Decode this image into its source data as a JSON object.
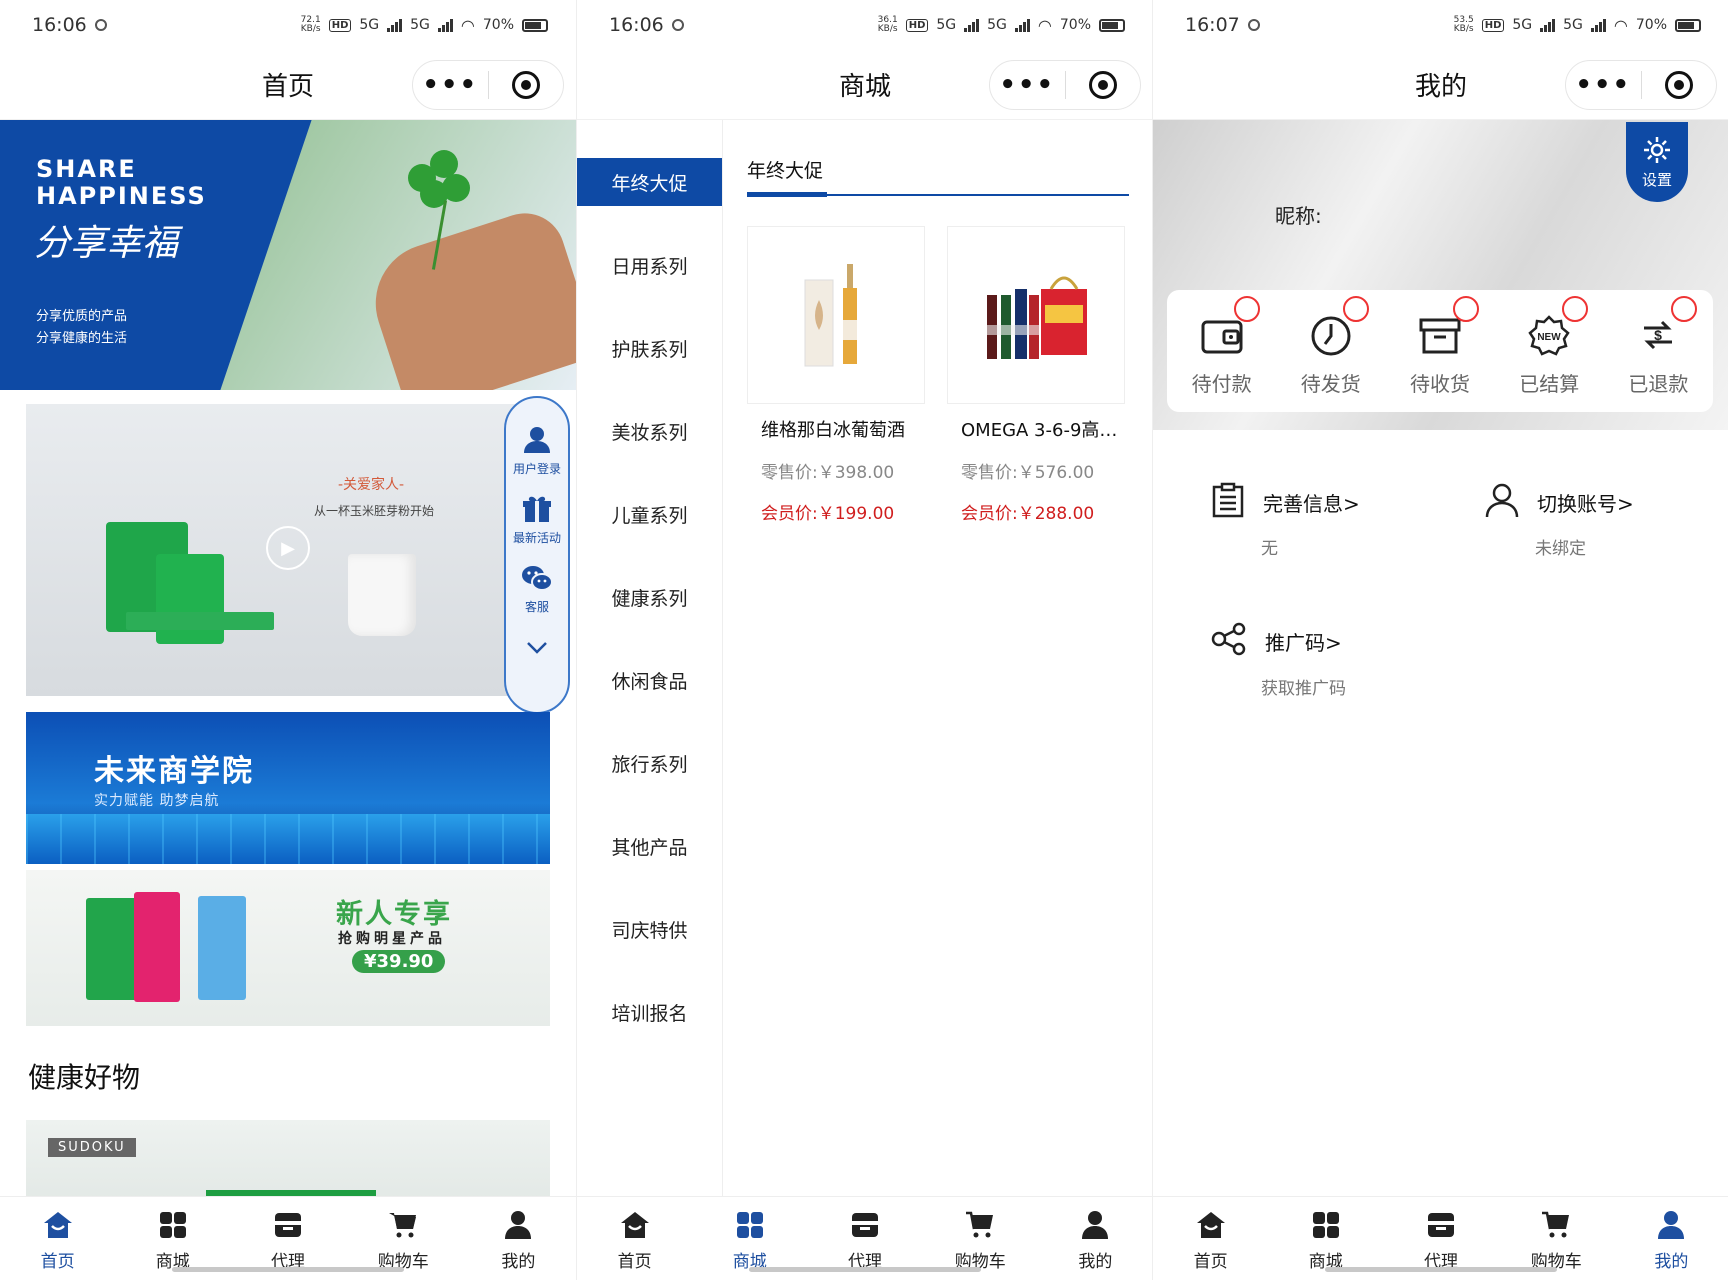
{
  "panels": [
    {
      "status": {
        "time": "16:06",
        "speed": "72.1",
        "speed_unit": "KB/s",
        "hd": "HD",
        "net1": "5G",
        "net2": "5G",
        "battery": "70%"
      },
      "title": "首页"
    },
    {
      "status": {
        "time": "16:06",
        "speed": "36.1",
        "speed_unit": "KB/s",
        "hd": "HD",
        "net1": "5G",
        "net2": "5G",
        "battery": "70%"
      },
      "title": "商城"
    },
    {
      "status": {
        "time": "16:07",
        "speed": "53.5",
        "speed_unit": "KB/s",
        "hd": "HD",
        "net1": "5G",
        "net2": "5G",
        "battery": "70%"
      },
      "title": "我的"
    }
  ],
  "capsule": {
    "more": "•••"
  },
  "home": {
    "hero": {
      "line1": "SHARE",
      "line2": "HAPPINESS",
      "script": "分享幸福",
      "sub1": "分享优质的产品",
      "sub2": "分享健康的生活"
    },
    "promo": {
      "slogan": "-关爱家人-",
      "sub": "从一杯玉米胚芽粉开始"
    },
    "float": {
      "login": "用户登录",
      "activity": "最新活动",
      "service": "客服"
    },
    "academy": {
      "title": "未来商学院",
      "sub": "实力赋能 助梦启航"
    },
    "newuser": {
      "title": "新人专享",
      "sub": "抢购明星产品",
      "price": "¥39.90"
    },
    "section_title": "健康好物",
    "brand": "SUDOKU"
  },
  "shop": {
    "categories": [
      "年终大促",
      "日用系列",
      "护肤系列",
      "美妆系列",
      "儿童系列",
      "健康系列",
      "休闲食品",
      "旅行系列",
      "其他产品",
      "司庆特供",
      "培训报名"
    ],
    "active_tab": "年终大促",
    "products": [
      {
        "name": "维格那白冰葡萄酒",
        "retail": "零售价:￥398.00",
        "member": "会员价:￥199.00"
      },
      {
        "name": "OMEGA 3-6-9高…",
        "retail": "零售价:￥576.00",
        "member": "会员价:￥288.00"
      }
    ]
  },
  "me": {
    "settings": "设置",
    "nickname": "昵称:",
    "orders": [
      "待付款",
      "待发货",
      "待收货",
      "已结算",
      "已退款"
    ],
    "info": {
      "complete": "完善信息>",
      "complete_val": "无",
      "switch": "切换账号>",
      "switch_val": "未绑定",
      "promo": "推广码>",
      "promo_val": "获取推广码"
    }
  },
  "tabs": [
    "首页",
    "商城",
    "代理",
    "购物车",
    "我的"
  ],
  "colors": {
    "primary": "#0e4aa5",
    "price_red": "#d01e1e",
    "badge": "#ee3333"
  }
}
